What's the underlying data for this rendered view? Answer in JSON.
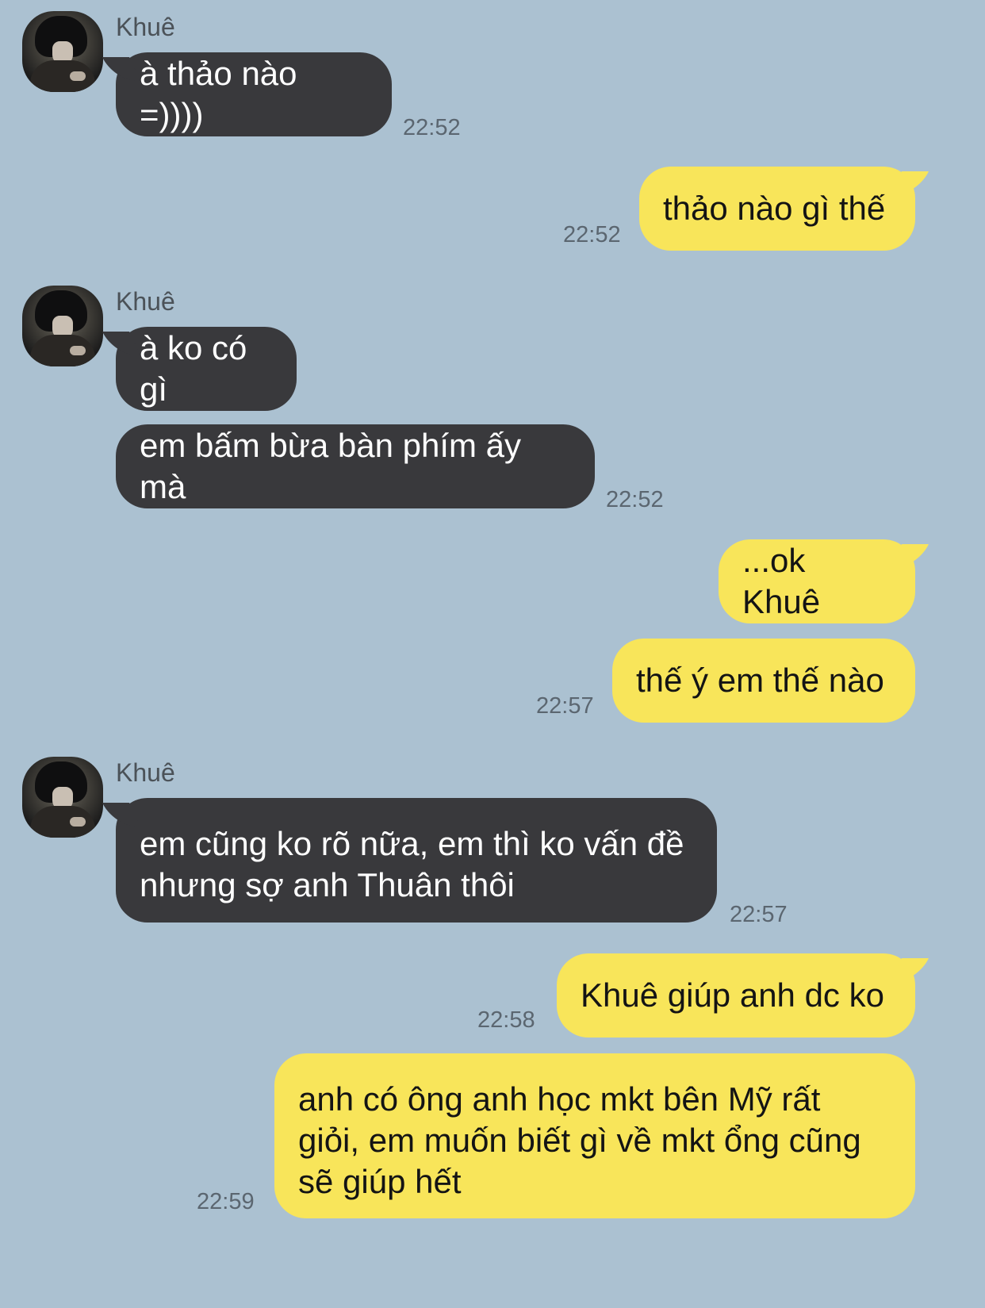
{
  "contact": {
    "name": "Khuê"
  },
  "messages": [
    {
      "side": "left",
      "text": "à thảo nào =))))",
      "time": "22:52"
    },
    {
      "side": "right",
      "text": "thảo nào gì thế",
      "time": "22:52"
    },
    {
      "side": "left",
      "text": "à ko có gì"
    },
    {
      "side": "left",
      "text": "em bấm bừa bàn phím ấy mà",
      "time": "22:52"
    },
    {
      "side": "right",
      "text": "...ok Khuê"
    },
    {
      "side": "right",
      "text": "thế ý em thế nào",
      "time": "22:57"
    },
    {
      "side": "left",
      "text_line1": "em cũng ko rõ nữa, em thì ko vấn đề",
      "text_line2": "nhưng sợ anh Thuân thôi",
      "time": "22:57"
    },
    {
      "side": "right",
      "text": "Khuê giúp anh dc ko",
      "time": "22:58"
    },
    {
      "side": "right",
      "text_line1": "anh có ông anh học mkt bên Mỹ rất",
      "text_line2": "giỏi, em muốn biết gì về mkt ổng cũng",
      "text_line3": "sẽ giúp hết",
      "time": "22:59"
    }
  ],
  "colors": {
    "background": "#abc1d1",
    "incoming_bubble": "#39393c",
    "outgoing_bubble": "#f8e55a"
  }
}
